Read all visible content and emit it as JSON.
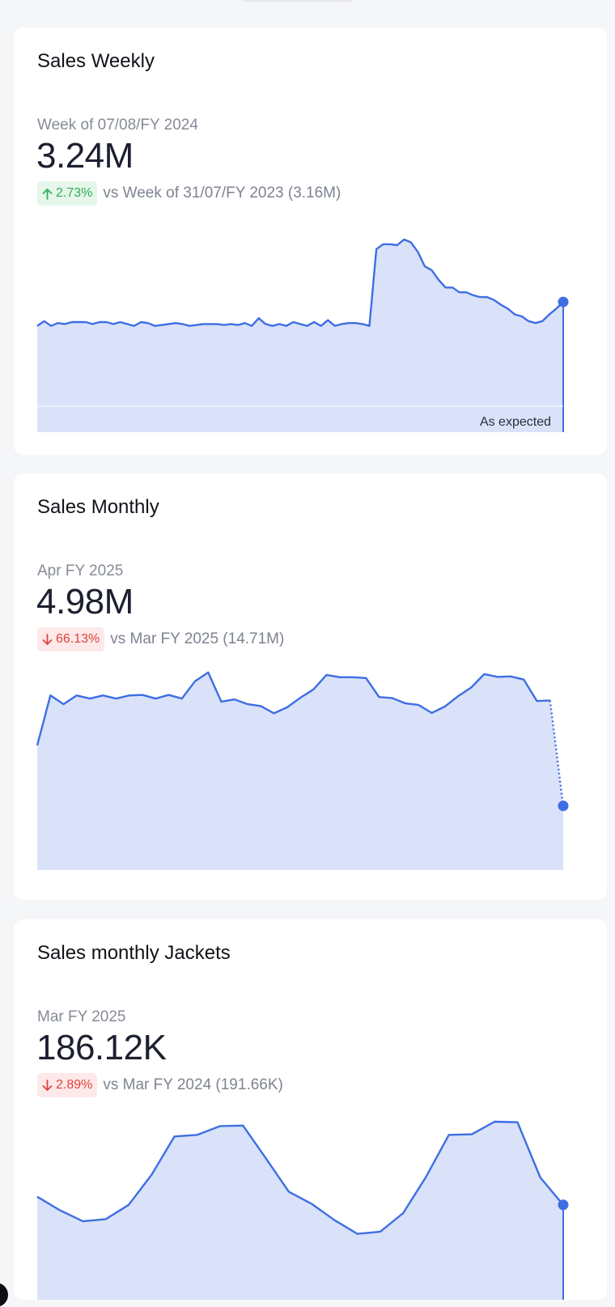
{
  "cards": [
    {
      "title": "Sales Weekly",
      "period": "Week of 07/08/FY 2024",
      "value": "3.24M",
      "change": {
        "direction": "up",
        "percent": "2.73%",
        "arrow_icon": "arrow-up-icon"
      },
      "comparison": "vs Week of 31/07/FY 2023 (3.16M)",
      "annotation": "As expected",
      "chart_data": {
        "type": "area",
        "y": [
          5.2,
          5.25,
          5.2,
          5.23,
          5.22,
          5.24,
          5.24,
          5.24,
          5.22,
          5.24,
          5.24,
          5.22,
          5.24,
          5.22,
          5.2,
          5.24,
          5.23,
          5.2,
          5.21,
          5.22,
          5.23,
          5.22,
          5.2,
          5.21,
          5.22,
          5.22,
          5.22,
          5.21,
          5.22,
          5.21,
          5.23,
          5.2,
          5.28,
          5.22,
          5.2,
          5.22,
          5.2,
          5.24,
          5.22,
          5.2,
          5.24,
          5.2,
          5.26,
          5.2,
          5.22,
          5.23,
          5.23,
          5.22,
          5.2,
          6.0,
          6.05,
          6.05,
          6.04,
          6.1,
          6.07,
          5.97,
          5.82,
          5.78,
          5.68,
          5.6,
          5.6,
          5.55,
          5.55,
          5.52,
          5.5,
          5.5,
          5.47,
          5.42,
          5.38,
          5.32,
          5.3,
          5.25,
          5.23,
          5.25,
          5.32,
          5.38,
          5.45
        ],
        "highlight_last": true,
        "color": "#3e6ee3",
        "fill": "#d9e2f9"
      }
    },
    {
      "title": "Sales Monthly",
      "period": "Apr FY 2025",
      "value": "4.98M",
      "change": {
        "direction": "down",
        "percent": "66.13%",
        "arrow_icon": "arrow-down-icon"
      },
      "comparison": "vs Mar FY 2025 (14.71M)",
      "chart_data": {
        "type": "area",
        "y": [
          8.8,
          11.95,
          11.4,
          11.95,
          11.75,
          11.95,
          11.75,
          11.95,
          11.98,
          11.75,
          11.98,
          11.75,
          12.85,
          13.4,
          11.55,
          11.7,
          11.4,
          11.28,
          10.82,
          11.2,
          11.8,
          12.33,
          13.25,
          13.1,
          13.1,
          13.05,
          11.85,
          11.78,
          11.45,
          11.35,
          10.85,
          11.25,
          11.9,
          12.45,
          13.3,
          13.12,
          13.15,
          12.95,
          11.6,
          11.63,
          4.98
        ],
        "last_segment_dotted": true,
        "highlight_last": true,
        "color": "#3e6ee3",
        "fill": "#d9e2f9"
      }
    },
    {
      "title": "Sales monthly Jackets",
      "period": "Mar FY 2025",
      "value": "186.12K",
      "change": {
        "direction": "down",
        "percent": "2.89%",
        "arrow_icon": "arrow-down-icon"
      },
      "comparison": "vs Mar FY 2024 (191.66K)",
      "chart_data": {
        "type": "area",
        "y": [
          175,
          172.5,
          170.5,
          170.9,
          173.5,
          179,
          186,
          186.3,
          187.9,
          188,
          182,
          175.9,
          173.7,
          170.7,
          168.2,
          168.6,
          172,
          178.6,
          186.3,
          186.4,
          188.7,
          188.6,
          178.5,
          173.5
        ],
        "highlight_last": true,
        "color": "#3e6ee3",
        "fill": "#d9e2f9"
      }
    }
  ]
}
